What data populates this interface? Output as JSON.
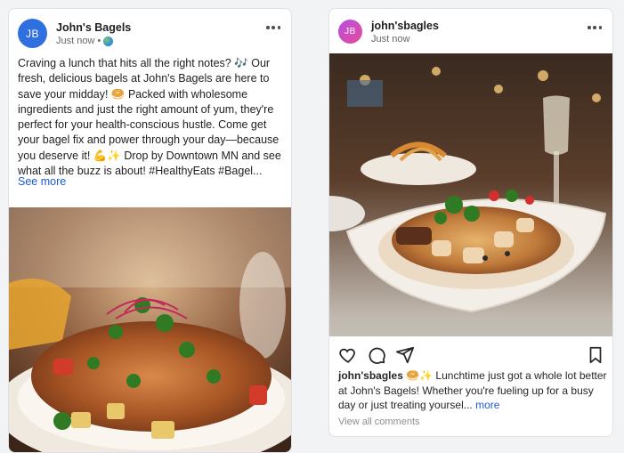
{
  "facebook_post": {
    "avatar_initials": "JB",
    "author": "John's Bagels",
    "timestamp": "Just now",
    "separator": "•",
    "audience_icon": "globe-icon",
    "menu_icon": "more-horizontal-icon",
    "body": "Craving a lunch that hits all the right notes? 🎶 Our fresh, delicious bagels at John's Bagels are here to save your midday! 🥯 Packed with wholesome ingredients and just the right amount of yum, they're perfect for your health-conscious hustle. Come get your bagel fix and power through your day—because you deserve it! 💪✨ Drop by Downtown MN and see what all the buzz is about! #HealthyEats #Bagel...",
    "see_more": "See more",
    "image": "photo of grilled chicken dish with salad and fries on a plate in restaurant"
  },
  "instagram_post": {
    "avatar_initials": "JB",
    "username": "john'sbagles",
    "timestamp": "Just now",
    "menu_icon": "more-horizontal-icon",
    "image": "photo of grilled meat and chicken dish on a white plate with wine glass in restaurant",
    "actions": {
      "like_icon": "heart-icon",
      "comment_icon": "comment-icon",
      "share_icon": "send-icon",
      "save_icon": "bookmark-icon"
    },
    "caption_user": "john'sbagles",
    "caption_text": "🥯✨ Lunchtime just got a whole lot better at John's Bagels! Whether you're fueling up for a busy day or just treating yoursel...",
    "caption_more": "more",
    "view_comments": "View all comments"
  },
  "colors": {
    "fb_avatar": "#2f6fe0",
    "link_blue": "#1d58d8",
    "card_border": "#dfe1e5",
    "page_bg": "#f2f3f5"
  }
}
